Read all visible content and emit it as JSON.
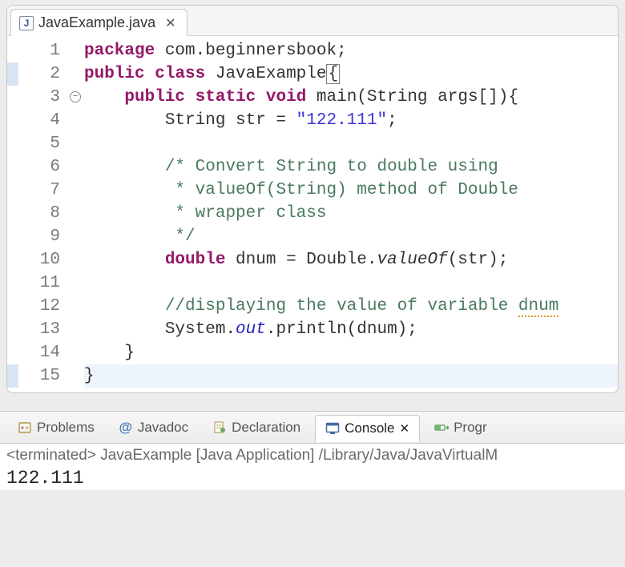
{
  "editor": {
    "tab": {
      "icon_letter": "J",
      "title": "JavaExample.java"
    },
    "lines": [
      {
        "n": 1,
        "hl": false,
        "fold": false
      },
      {
        "n": 2,
        "hl": true,
        "fold": false
      },
      {
        "n": 3,
        "hl": false,
        "fold": true
      },
      {
        "n": 4,
        "hl": false,
        "fold": false
      },
      {
        "n": 5,
        "hl": false,
        "fold": false
      },
      {
        "n": 6,
        "hl": false,
        "fold": false
      },
      {
        "n": 7,
        "hl": false,
        "fold": false
      },
      {
        "n": 8,
        "hl": false,
        "fold": false
      },
      {
        "n": 9,
        "hl": false,
        "fold": false
      },
      {
        "n": 10,
        "hl": false,
        "fold": false
      },
      {
        "n": 11,
        "hl": false,
        "fold": false
      },
      {
        "n": 12,
        "hl": false,
        "fold": false
      },
      {
        "n": 13,
        "hl": false,
        "fold": false
      },
      {
        "n": 14,
        "hl": false,
        "fold": false
      },
      {
        "n": 15,
        "hl": true,
        "fold": false,
        "current": true
      }
    ],
    "tokens": {
      "l1_package": "package",
      "l1_pkg": " com.beginnersbook;",
      "l2_public": "public",
      "l2_class": "class",
      "l2_name": " JavaExample",
      "l2_brace": "{",
      "l3_public": "public",
      "l3_static": "static",
      "l3_void": "void",
      "l3_main": " main(String args[]){",
      "l4_type": "String",
      "l4_rest1": " str = ",
      "l4_str": "\"122.111\"",
      "l4_rest2": ";",
      "l6_c": "/* Convert String to double using",
      "l7_c": " * valueOf(String) method of Double",
      "l8_c": " * wrapper class",
      "l9_c": " */",
      "l10_type": "double",
      "l10_rest1": " dnum = Double.",
      "l10_valueof": "valueOf",
      "l10_rest2": "(str);",
      "l12_c1": "//displaying the value of variable ",
      "l12_c2": "dnum",
      "l13_a": "System.",
      "l13_out": "out",
      "l13_b": ".println(dnum);",
      "l14": "}",
      "l15": "}"
    }
  },
  "views": {
    "problems": "Problems",
    "javadoc": "Javadoc",
    "declaration": "Declaration",
    "console": "Console",
    "progress": "Progr"
  },
  "console": {
    "status": "<terminated> JavaExample [Java Application] /Library/Java/JavaVirtualM",
    "output": "122.111"
  },
  "icons": {
    "at": "@"
  }
}
